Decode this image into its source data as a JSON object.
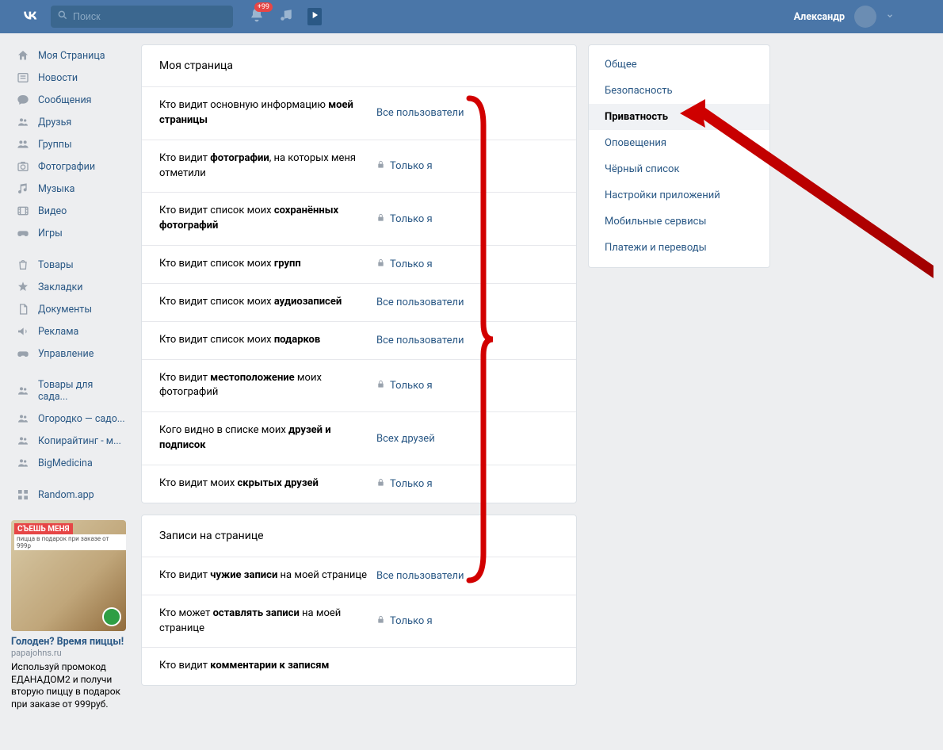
{
  "header": {
    "search_placeholder": "Поиск",
    "notification_badge": "+99",
    "user_name": "Александр"
  },
  "left_nav": {
    "main": [
      {
        "icon": "home",
        "label": "Моя Страница"
      },
      {
        "icon": "news",
        "label": "Новости"
      },
      {
        "icon": "msg",
        "label": "Сообщения"
      },
      {
        "icon": "friends",
        "label": "Друзья"
      },
      {
        "icon": "groups",
        "label": "Группы"
      },
      {
        "icon": "photo",
        "label": "Фотографии"
      },
      {
        "icon": "music",
        "label": "Музыка"
      },
      {
        "icon": "video",
        "label": "Видео"
      },
      {
        "icon": "games",
        "label": "Игры"
      }
    ],
    "secondary": [
      {
        "icon": "goods",
        "label": "Товары"
      },
      {
        "icon": "bookmark",
        "label": "Закладки"
      },
      {
        "icon": "docs",
        "label": "Документы"
      },
      {
        "icon": "ads",
        "label": "Реклама"
      },
      {
        "icon": "manage",
        "label": "Управление"
      }
    ],
    "groups": [
      {
        "icon": "friends",
        "label": "Товары для сада..."
      },
      {
        "icon": "friends",
        "label": "Огородко — садо..."
      },
      {
        "icon": "friends",
        "label": "Копирайтинг - м..."
      },
      {
        "icon": "friends",
        "label": "BigMedicina"
      }
    ],
    "apps": [
      {
        "icon": "app",
        "label": "Random.app"
      }
    ]
  },
  "ad": {
    "stripe": "СЪЕШЬ МЕНЯ",
    "stripe2": "пицца в подарок при заказе от 999р",
    "title": "Голоден? Время пиццы!",
    "domain": "papajohns.ru",
    "text": "Используй промокод ЕДАНАДОМ2 и получи вторую пиццу в подарок при заказе от 999руб."
  },
  "main": {
    "section1_title": "Моя страница",
    "section2_title": "Записи на странице",
    "privacy_rows": [
      {
        "label_pre": "Кто видит основную информацию ",
        "label_b": "моей страницы",
        "label_post": "",
        "value": "Все пользователи",
        "lock": false
      },
      {
        "label_pre": "Кто видит ",
        "label_b": "фотографии",
        "label_post": ", на которых меня отметили",
        "value": "Только я",
        "lock": true
      },
      {
        "label_pre": "Кто видит список моих ",
        "label_b": "сохранённых фотографий",
        "label_post": "",
        "value": "Только я",
        "lock": true
      },
      {
        "label_pre": "Кто видит список моих ",
        "label_b": "групп",
        "label_post": "",
        "value": "Только я",
        "lock": true
      },
      {
        "label_pre": "Кто видит список моих ",
        "label_b": "аудиозаписей",
        "label_post": "",
        "value": "Все пользователи",
        "lock": false
      },
      {
        "label_pre": "Кто видит список моих ",
        "label_b": "подарков",
        "label_post": "",
        "value": "Все пользователи",
        "lock": false
      },
      {
        "label_pre": "Кто видит ",
        "label_b": "местоположение",
        "label_post": " моих фотографий",
        "value": "Только я",
        "lock": true
      },
      {
        "label_pre": "Кого видно в списке моих ",
        "label_b": "друзей и подписок",
        "label_post": "",
        "value": "Всех друзей",
        "lock": false
      },
      {
        "label_pre": "Кто видит моих ",
        "label_b": "скрытых друзей",
        "label_post": "",
        "value": "Только я",
        "lock": true
      }
    ],
    "posts_rows": [
      {
        "label_pre": "Кто видит ",
        "label_b": "чужие записи",
        "label_post": " на моей странице",
        "value": "Все пользователи",
        "lock": false
      },
      {
        "label_pre": "Кто может ",
        "label_b": "оставлять записи",
        "label_post": " на моей странице",
        "value": "Только я",
        "lock": true
      },
      {
        "label_pre": "Кто видит ",
        "label_b": "комментарии к записям",
        "label_post": "",
        "value": "",
        "lock": false
      }
    ]
  },
  "settings_menu": [
    {
      "label": "Общее",
      "active": false
    },
    {
      "label": "Безопасность",
      "active": false
    },
    {
      "label": "Приватность",
      "active": true
    },
    {
      "label": "Оповещения",
      "active": false
    },
    {
      "label": "Чёрный список",
      "active": false
    },
    {
      "label": "Настройки приложений",
      "active": false
    },
    {
      "label": "Мобильные сервисы",
      "active": false
    },
    {
      "label": "Платежи и переводы",
      "active": false
    }
  ]
}
